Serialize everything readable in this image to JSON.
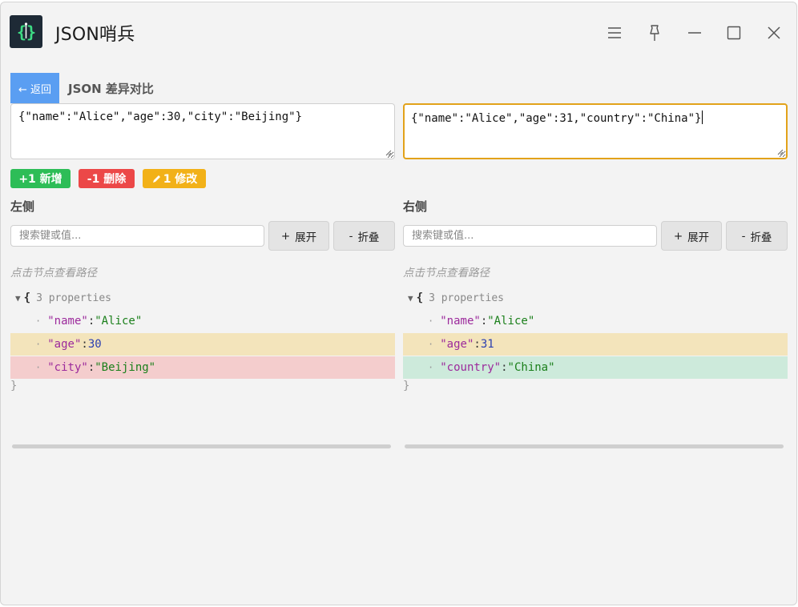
{
  "app": {
    "title": "JSON哨兵",
    "logo_icon": "curly-braces-icon"
  },
  "window_controls": {
    "menu_icon": "hamburger-menu-icon",
    "pin_icon": "pin-icon",
    "minimize_icon": "minimize-icon",
    "maximize_icon": "maximize-icon",
    "close_icon": "close-icon"
  },
  "header": {
    "back_label": "← 返回",
    "page_title": "JSON 差异对比"
  },
  "inputs": {
    "left_value": "{\"name\":\"Alice\",\"age\":30,\"city\":\"Beijing\"}",
    "right_value": "{\"name\":\"Alice\",\"age\":31,\"country\":\"China\"}"
  },
  "summary": {
    "added": "+1 新增",
    "removed": "-1 删除",
    "modified": "1 修改",
    "modified_icon": "pencil-icon",
    "colors": {
      "added": "#2dbd57",
      "removed": "#ec4848",
      "modified": "#f2b118"
    }
  },
  "panels": {
    "left": {
      "title": "左侧",
      "search_placeholder": "搜索键或值...",
      "expand_label": "展开",
      "collapse_label": "折叠",
      "path_hint": "点击节点查看路径",
      "tree_summary": "3 properties",
      "rows": [
        {
          "key": "\"name\"",
          "value": "\"Alice\"",
          "value_type": "string",
          "status": "unchanged"
        },
        {
          "key": "\"age\"",
          "value": "30",
          "value_type": "number",
          "status": "changed"
        },
        {
          "key": "\"city\"",
          "value": "\"Beijing\"",
          "value_type": "string",
          "status": "removed"
        }
      ]
    },
    "right": {
      "title": "右侧",
      "search_placeholder": "搜索键或值...",
      "expand_label": "展开",
      "collapse_label": "折叠",
      "path_hint": "点击节点查看路径",
      "tree_summary": "3 properties",
      "rows": [
        {
          "key": "\"name\"",
          "value": "\"Alice\"",
          "value_type": "string",
          "status": "unchanged"
        },
        {
          "key": "\"age\"",
          "value": "31",
          "value_type": "number",
          "status": "changed"
        },
        {
          "key": "\"country\"",
          "value": "\"China\"",
          "value_type": "string",
          "status": "added"
        }
      ]
    }
  },
  "tree_glyphs": {
    "open_brace": "{",
    "close_brace": "}",
    "colon": ":",
    "toggle": "▼",
    "bullet": "·"
  }
}
